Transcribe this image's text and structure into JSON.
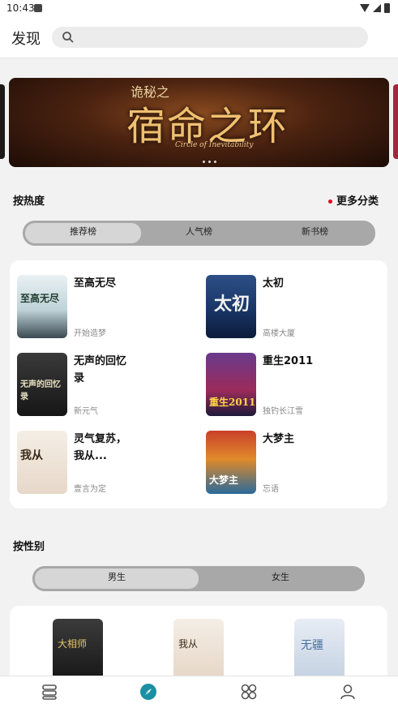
{
  "status": {
    "time": "10:43"
  },
  "header": {
    "title": "发现",
    "search_placeholder": ""
  },
  "banner": {
    "title_cn": "宿命之环",
    "title_small": "诡秘之",
    "title_en": "Circle of Inevitability"
  },
  "hot": {
    "title": "按热度",
    "more": "更多分类",
    "tabs": [
      "推荐榜",
      "人气榜",
      "新书榜"
    ],
    "books": [
      {
        "name": "至高无尽",
        "author": "开始造梦",
        "cover_text": "至高无尽"
      },
      {
        "name": "太初",
        "author": "高楼大厦",
        "cover_text": "太初"
      },
      {
        "name": "无声的回忆录",
        "author": "新元气",
        "cover_text": "无声的回忆录"
      },
      {
        "name": "重生2011",
        "author": "独钓长江雪",
        "cover_text": "重生2011"
      },
      {
        "name": "灵气复苏，我从...",
        "author": "壹言为定",
        "cover_text": "我从"
      },
      {
        "name": "大梦主",
        "author": "忘语",
        "cover_text": "大梦主"
      }
    ]
  },
  "gender": {
    "title": "按性别",
    "tabs": [
      "男生",
      "女生"
    ],
    "covers": [
      "大相师",
      "我从",
      "无疆"
    ]
  },
  "nav": [
    "shelf",
    "discover",
    "category",
    "profile"
  ],
  "colors": {
    "accent": "#1b8fa3",
    "dot": "#e0001b"
  }
}
